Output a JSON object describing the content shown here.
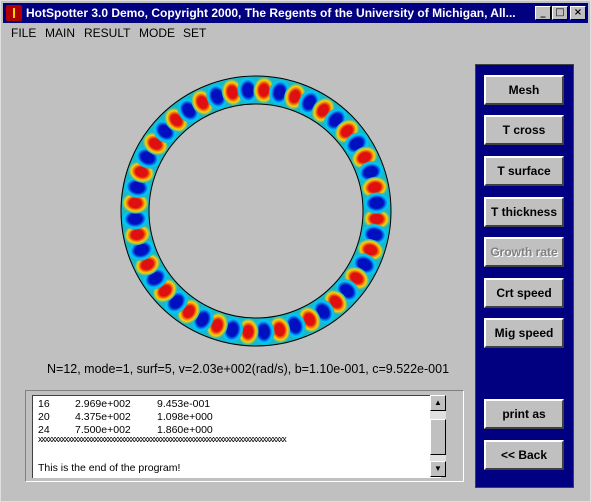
{
  "window": {
    "title": "HotSpotter 3.0 Demo,  Copyright 2000,  The Regents of the University of Michigan,  All...",
    "controls": {
      "minimize": "_",
      "maximize": "□",
      "close": "×"
    }
  },
  "menu": [
    "FILE",
    "MAIN",
    "RESULT",
    "MODE",
    "SET"
  ],
  "plot": {
    "info": "N=12, mode=1, surf=5, v=2.03e+002(rad/s), b=1.10e-001, c=9.522e-001",
    "spots": 24,
    "colors": {
      "hot": "#e01010",
      "warm": "#ffd000",
      "mid": "#00c8ff",
      "cold": "#0010c0",
      "base": "#18b8c8"
    }
  },
  "results": {
    "rows": [
      {
        "n": "16",
        "speed": "2.969e+002",
        "ratio": "9.453e-001"
      },
      {
        "n": "20",
        "speed": "4.375e+002",
        "ratio": "1.098e+000"
      },
      {
        "n": "24",
        "speed": "7.500e+002",
        "ratio": "1.860e+000"
      }
    ],
    "separator": "xxxxxxxxxxxxxxxxxxxxxxxxxxxxxxxxxxxxxxxxxxxxxxxxxxxxxxxxxxxxxxxxxxxxxxxxxxx",
    "end_message": "This is the end of the program!"
  },
  "panel": {
    "accent": "#000080",
    "buttons": [
      {
        "label": "Mesh",
        "enabled": true
      },
      {
        "label": "T cross",
        "enabled": true
      },
      {
        "label": "T surface",
        "enabled": true
      },
      {
        "label": "T thickness",
        "enabled": true
      },
      {
        "label": "Growth rate",
        "enabled": false
      },
      {
        "label": "Crt speed",
        "enabled": true
      },
      {
        "label": "Mig speed",
        "enabled": true
      }
    ],
    "print_label": "print as",
    "back_label": "<< Back"
  }
}
